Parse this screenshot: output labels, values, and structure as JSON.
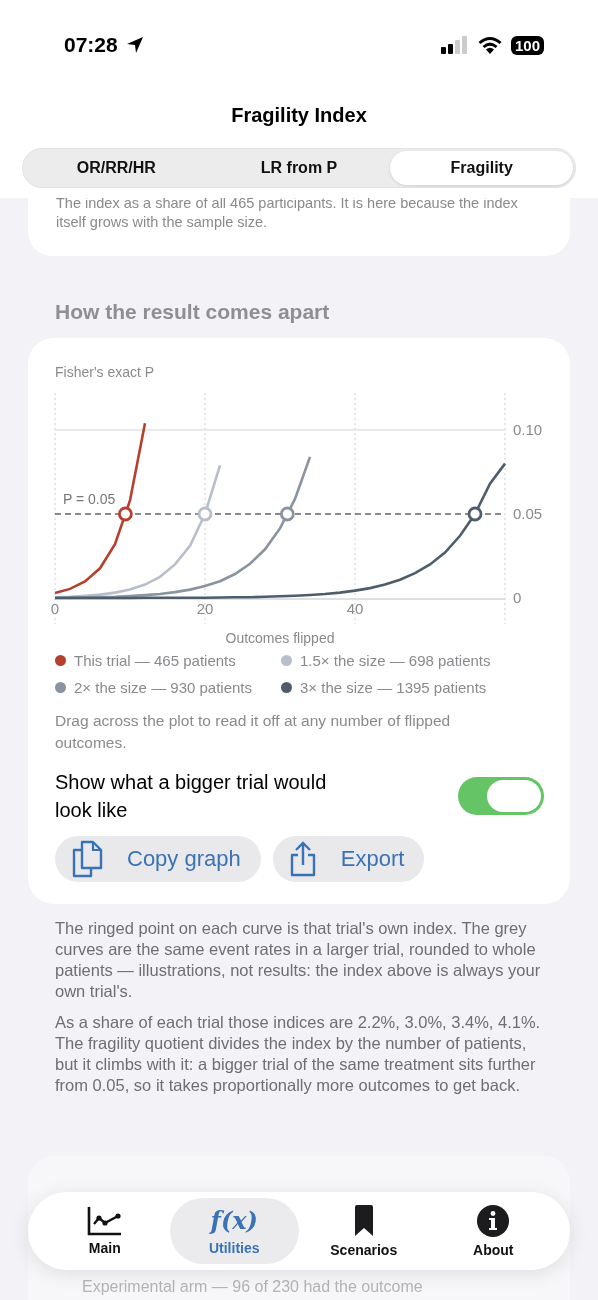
{
  "status_bar": {
    "time": "07:28",
    "battery": "100"
  },
  "title": "Fragility Index",
  "tabs": [
    {
      "label": "OR/RR/HR",
      "selected": false
    },
    {
      "label": "LR from P",
      "selected": false
    },
    {
      "label": "Fragility",
      "selected": true
    }
  ],
  "top_card": {
    "text": "The index as a share of all 465 participants. It is here because the index itself grows with the sample size."
  },
  "section_title": "How the result comes apart",
  "chart_card": {
    "chart_data": {
      "type": "line",
      "ylabel": "Fisher's exact P",
      "xlabel": "Outcomes flipped",
      "x": [
        0,
        2,
        4,
        6,
        8,
        10,
        12,
        14,
        16,
        18,
        20,
        22,
        24,
        26,
        28,
        30,
        32,
        34,
        36,
        38,
        40,
        42,
        44,
        46,
        48,
        50,
        52,
        54,
        56,
        58,
        60
      ],
      "xlim": [
        0,
        60
      ],
      "ylim": [
        0,
        0.122
      ],
      "xticks": [
        0,
        20,
        40
      ],
      "yticks": [
        {
          "value": 0,
          "label": "0"
        },
        {
          "value": 0.05,
          "label": "0.05"
        },
        {
          "value": 0.1,
          "label": "0.10"
        }
      ],
      "series": [
        {
          "name": "This trial — 465 patients",
          "color": "#b5402f",
          "values": [
            0.003,
            0.0054,
            0.0098,
            0.0177,
            0.032,
            0.058,
            0.104,
            null,
            null,
            null,
            null,
            null,
            null,
            null,
            null,
            null,
            null,
            null,
            null,
            null,
            null,
            null,
            null,
            null,
            null,
            null,
            null,
            null,
            null,
            null,
            null
          ]
        },
        {
          "name": "1.5× the size — 698 patients",
          "color": "#b8bfca",
          "values": [
            0.0005,
            0.0008,
            0.0013,
            0.002,
            0.0032,
            0.005,
            0.008,
            0.0126,
            0.02,
            0.031,
            0.05,
            0.079,
            null,
            null,
            null,
            null,
            null,
            null,
            null,
            null,
            null,
            null,
            null,
            null,
            null,
            null,
            null,
            null,
            null,
            null,
            null
          ]
        },
        {
          "name": "2× the size — 930 patients",
          "color": "#8a93a0",
          "values": [
            0.0002,
            0.0003,
            0.0004,
            0.0006,
            0.0008,
            0.0012,
            0.0017,
            0.0024,
            0.0035,
            0.005,
            0.0071,
            0.01,
            0.0143,
            0.0204,
            0.029,
            0.0414,
            0.059,
            0.084,
            null,
            null,
            null,
            null,
            null,
            null,
            null,
            null,
            null,
            null,
            null,
            null,
            null
          ]
        },
        {
          "name": "3× the size — 1395 patients",
          "color": "#4f5d6b",
          "values": [
            0,
            0,
            0,
            0,
            0,
            0,
            0.0001,
            0.0001,
            0.0001,
            0.0002,
            0.0002,
            0.0003,
            0.0004,
            0.0005,
            0.0007,
            0.001,
            0.0013,
            0.0018,
            0.0024,
            0.0032,
            0.0044,
            0.0059,
            0.008,
            0.0109,
            0.0148,
            0.02,
            0.027,
            0.037,
            0.05,
            0.068,
            0.08
          ]
        }
      ],
      "ref_lines": [
        {
          "axis": "y",
          "value": 0.1
        },
        {
          "axis": "y",
          "value": 0.05,
          "label": "P = 0.05"
        }
      ]
    },
    "hint": "Drag across the plot to read it off at any number of flipped outcomes.",
    "toggle": {
      "label": "Show what a bigger trial would look like",
      "on": true
    },
    "buttons": [
      {
        "label": "Copy graph",
        "kind": "copy"
      },
      {
        "label": "Export",
        "kind": "export"
      }
    ]
  },
  "notes": [
    "The ringed point on each curve is that trial's own index. The grey curves are the same event rates in a larger trial, rounded to whole patients — illustrations, not results: the index above is always your own trial's.",
    "As a share of each trial those indices are 2.2%, 3.0%, 3.4%, 4.1%. The fragility quotient divides the index by the number of patients, but it climbs with it: a bigger trial of the same treatment sits further from 0.05, so it takes proportionally more outcomes to get back."
  ],
  "behind_card": {
    "text": "Experimental arm — 96 of 230 had the outcome"
  },
  "tab_bar": [
    {
      "label": "Main",
      "kind": "chart",
      "selected": false
    },
    {
      "label": "Utilities",
      "kind": "function",
      "glyph": "f(x)",
      "selected": true
    },
    {
      "label": "Scenarios",
      "kind": "bookmark",
      "selected": false
    },
    {
      "label": "About",
      "kind": "info",
      "selected": false
    }
  ]
}
